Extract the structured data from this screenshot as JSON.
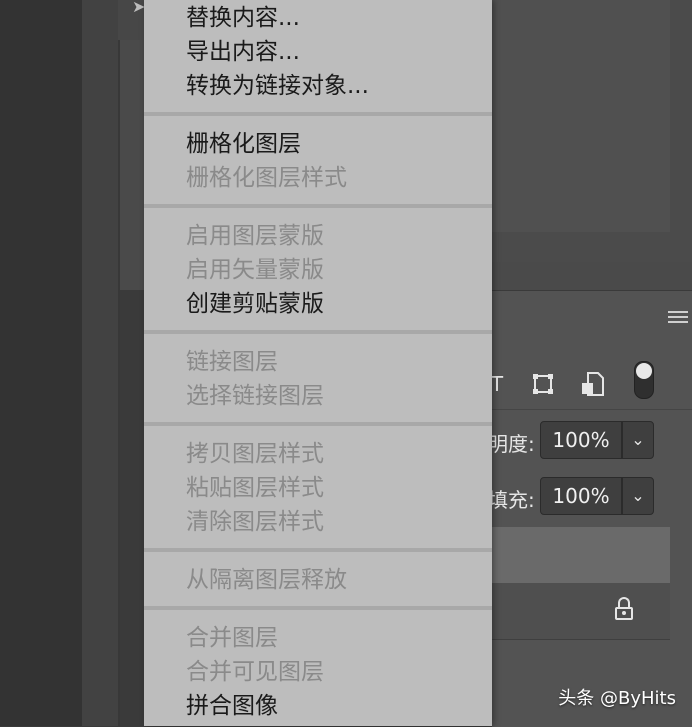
{
  "context_menu": {
    "groups": [
      {
        "items": [
          {
            "label": "替换内容...",
            "enabled": true
          },
          {
            "label": "导出内容...",
            "enabled": true
          },
          {
            "label": "转换为链接对象...",
            "enabled": true
          }
        ]
      },
      {
        "items": [
          {
            "label": "栅格化图层",
            "enabled": true
          },
          {
            "label": "栅格化图层样式",
            "enabled": false
          }
        ]
      },
      {
        "items": [
          {
            "label": "启用图层蒙版",
            "enabled": false
          },
          {
            "label": "启用矢量蒙版",
            "enabled": false
          },
          {
            "label": "创建剪贴蒙版",
            "enabled": true
          }
        ]
      },
      {
        "items": [
          {
            "label": "链接图层",
            "enabled": false
          },
          {
            "label": "选择链接图层",
            "enabled": false
          }
        ]
      },
      {
        "items": [
          {
            "label": "拷贝图层样式",
            "enabled": false
          },
          {
            "label": "粘贴图层样式",
            "enabled": false
          },
          {
            "label": "清除图层样式",
            "enabled": false
          }
        ]
      },
      {
        "items": [
          {
            "label": "从隔离图层释放",
            "enabled": false
          }
        ]
      },
      {
        "items": [
          {
            "label": "合并图层",
            "enabled": false
          },
          {
            "label": "合并可见图层",
            "enabled": false
          },
          {
            "label": "拼合图像",
            "enabled": true
          }
        ]
      }
    ]
  },
  "layers_panel": {
    "filter_icons": [
      "type-filter-icon",
      "shape-filter-icon",
      "smart-object-filter-icon"
    ],
    "filter_glyphs": {
      "type": "T"
    },
    "opacity": {
      "label": "明度:",
      "value": "100%"
    },
    "fill": {
      "label": "填充:",
      "value": "100%"
    },
    "dropdown_glyph": "⌄"
  },
  "watermark": "头条 @ByHits",
  "colors": {
    "menu_bg": "#bdbdbd",
    "menu_text_enabled": "#1a1a1a",
    "menu_text_disabled": "#8a8a8a",
    "panel_bg": "#535353"
  }
}
